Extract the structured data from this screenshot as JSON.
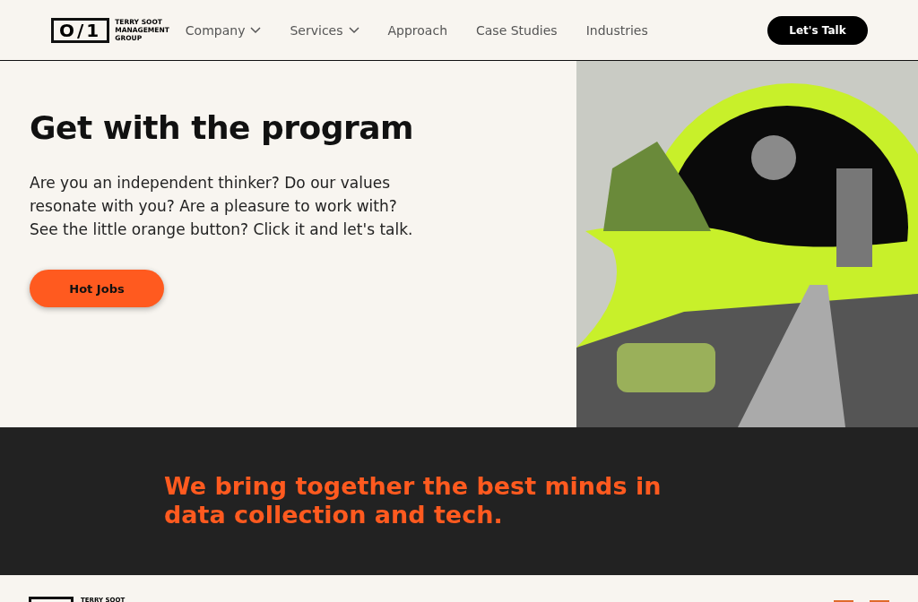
{
  "header": {
    "logo": {
      "mark": "O/1",
      "name": [
        "TERRY SOOT",
        "MANAGEMENT",
        "GROUP"
      ]
    },
    "nav": [
      {
        "label": "Company",
        "dropdown": true
      },
      {
        "label": "Services",
        "dropdown": true
      },
      {
        "label": "Approach",
        "dropdown": false
      },
      {
        "label": "Case Studies",
        "dropdown": false
      },
      {
        "label": "Industries",
        "dropdown": false
      }
    ],
    "cta": "Let's Talk"
  },
  "hero": {
    "title": "Get with the program",
    "body": "Are you an independent thinker? Do our values resonate with you? Are a pleasure to work with? See the little orange button? Click it and let's talk.",
    "button": "Hot Jobs"
  },
  "banner": {
    "text": "We bring together the best minds in data collection and tech."
  },
  "footer": {
    "logo_text": "TERRY SOOT"
  }
}
